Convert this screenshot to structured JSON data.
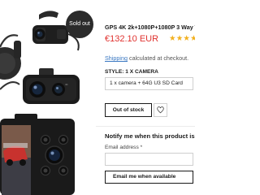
{
  "gallery": {
    "badge": "Sold out",
    "images": [
      "dash-cam-front-and-rear-camera",
      "dash-cam-display-unit"
    ]
  },
  "product": {
    "title": "GPS 4K 2k+1080P+1080P 3 Way Triple",
    "price": "€132.10 EUR",
    "rating_stars": "★★★★",
    "shipping_link": "Shipping",
    "shipping_rest": " calculated at checkout."
  },
  "variant": {
    "label": "STYLE: 1 X CAMERA",
    "selected": "1 x camera + 64G U3 SD Card"
  },
  "actions": {
    "out_of_stock": "Out of stock",
    "wishlist_icon": "heart-icon"
  },
  "notify": {
    "title": "Notify me when this product is available",
    "email_label": "Email address *",
    "email_value": "",
    "email_placeholder": "",
    "submit": "Email me when available"
  },
  "colors": {
    "price": "#e0322f",
    "stars": "#f2b01e",
    "link": "#3a78c2",
    "badge_bg": "#2b2b2b"
  }
}
